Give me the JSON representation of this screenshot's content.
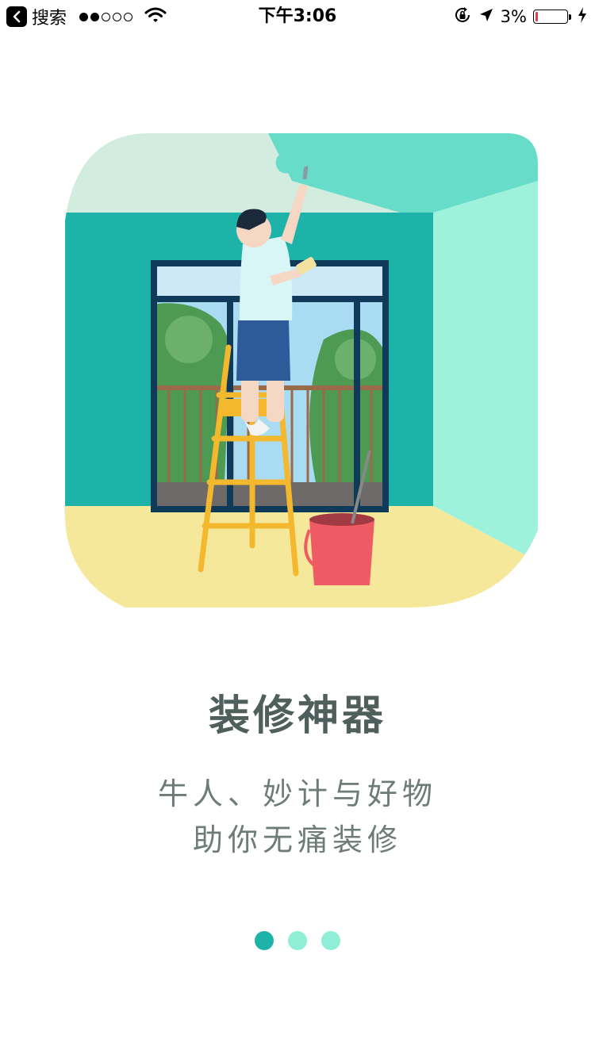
{
  "status_bar": {
    "back_label": "搜索",
    "time": "下午3:06",
    "battery_percent": "3%",
    "battery_level": 0.03,
    "signal_strength": 2,
    "signal_total": 5,
    "icons": [
      "back-arrow-icon",
      "wifi-icon",
      "rotation-lock-icon",
      "location-arrow-icon",
      "battery-icon",
      "charging-icon"
    ]
  },
  "illustration": {
    "subject": "painting-room-icon",
    "colors": {
      "wall": "#1eb3a8",
      "ceiling": "#d2ece0",
      "side_wall": "#9ef2dc",
      "floor": "#f6e89a",
      "ladder": "#f4b82e",
      "bucket": "#ef5b64"
    }
  },
  "onboarding": {
    "title": "装修神器",
    "subtitle_line1": "牛人、妙计与好物",
    "subtitle_line2": "助你无痛装修"
  },
  "pager": {
    "total": 3,
    "active_index": 0,
    "active_color": "#1eb3a8",
    "inactive_color": "#8eeed6"
  },
  "colors": {
    "battery_low": "#e8404a"
  }
}
